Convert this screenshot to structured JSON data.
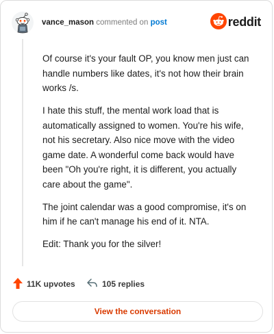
{
  "header": {
    "username": "vance_mason",
    "action_text": "commented on",
    "post_link": "post",
    "brand_name": "reddit"
  },
  "comment": {
    "paragraphs": [
      "Of course it's your fault OP, you know men just can handle numbers like dates, it's not how their brain works /s.",
      "I hate this stuff, the mental work load that is automatically assigned to women. You're his wife, not his secretary. Also nice move with the video game date. A wonderful come back would have been \"Oh you're right, it is different, you actually care about the game\".",
      "The joint calendar was a good compromise, it's on him if he can't manage his end of it. NTA.",
      "Edit: Thank you for the silver!"
    ]
  },
  "actions": {
    "upvotes": "11K upvotes",
    "replies": "105 replies"
  },
  "view_button": {
    "label": "View the conversation"
  },
  "colors": {
    "brand": "#ff4500",
    "link": "#0079d3",
    "button_text": "#d93a00"
  },
  "icons": {
    "avatar": "snoo-avatar",
    "brand": "reddit-logo-icon",
    "upvote": "upvote-arrow-icon",
    "reply": "reply-arrow-icon"
  }
}
